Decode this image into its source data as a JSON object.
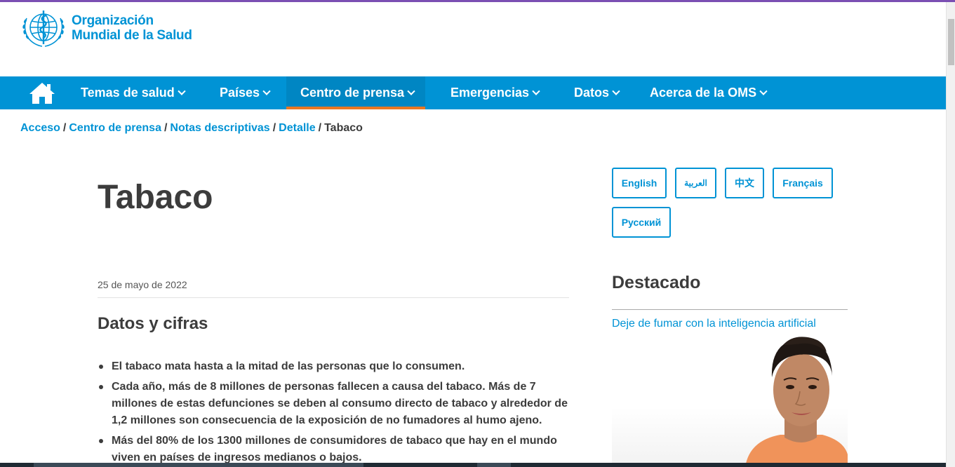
{
  "brand": {
    "line1": "Organización",
    "line2": "Mundial de la Salud"
  },
  "nav": {
    "items": [
      {
        "label": "Temas de salud"
      },
      {
        "label": "Países"
      },
      {
        "label": "Centro de prensa"
      },
      {
        "label": "Emergencias"
      },
      {
        "label": "Datos"
      },
      {
        "label": "Acerca de la OMS"
      }
    ]
  },
  "breadcrumb": {
    "items": [
      "Acceso",
      "Centro de prensa",
      "Notas descriptivas",
      "Detalle"
    ],
    "current": "Tabaco",
    "separator": "/"
  },
  "main": {
    "title": "Tabaco",
    "date": "25 de mayo de 2022",
    "section_title": "Datos y cifras",
    "facts": [
      "El tabaco mata hasta a la mitad de las personas que lo consumen.",
      "Cada año, más de 8 millones de personas fallecen a causa del tabaco. Más de 7 millones de estas defunciones se deben al consumo directo de tabaco y alrededor de 1,2 millones son consecuencia de la exposición de no fumadores al humo ajeno.",
      "Más del 80% de los 1300 millones de consumidores de tabaco que hay en el mundo viven en países de ingresos medianos o bajos."
    ]
  },
  "languages": [
    "English",
    "العربية",
    "中文",
    "Français",
    "Русский"
  ],
  "sidebar": {
    "title": "Destacado",
    "link": "Deje de fumar con la inteligencia artificial"
  },
  "colors": {
    "brand_blue": "#0093d5",
    "accent_orange": "#e87722",
    "text": "#3c3c3c"
  }
}
